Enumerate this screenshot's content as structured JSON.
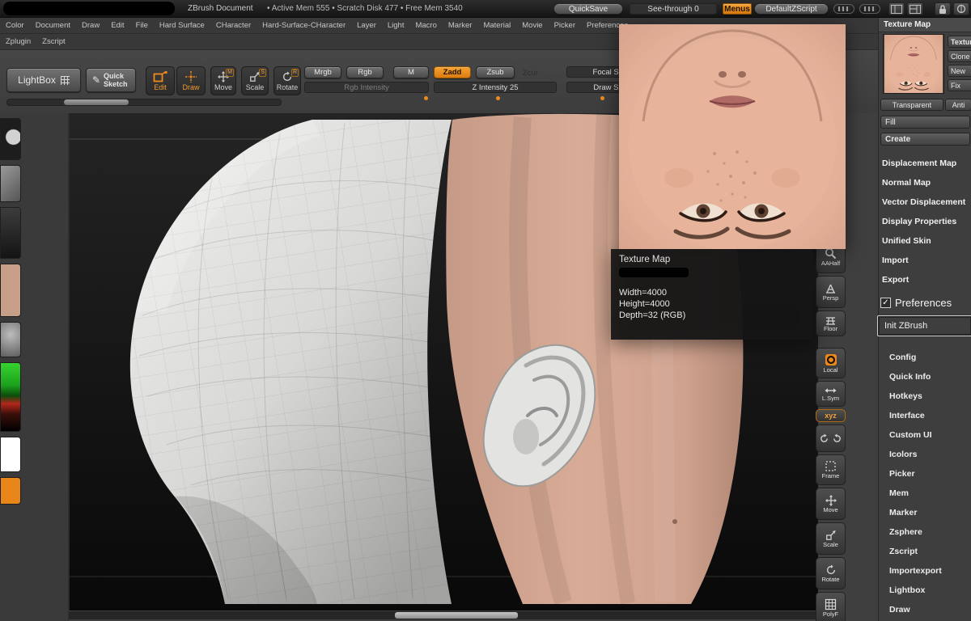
{
  "colors": {
    "accent": "#ee8a1c",
    "skin": "#d8ab96",
    "clay": "#dcdcda",
    "canvas_top": "#232323",
    "canvas_bottom": "#0a0a0a"
  },
  "title_bar": {
    "app_title": "ZBrush Document",
    "stats": "•  Active Mem 555   •  Scratch Disk 477   •  Free Mem 3540",
    "quicksave": "QuickSave",
    "see_through": "See-through  0",
    "menus": "Menus",
    "default_zscript": "DefaultZScript"
  },
  "menu_bar": {
    "row1": [
      "Color",
      "Document",
      "Draw",
      "Edit",
      "File",
      "Hard Surface",
      "CHaracter",
      "Hard-Surface-CHaracter",
      "Layer",
      "Light",
      "Macro",
      "Marker",
      "Material",
      "Movie",
      "Picker",
      "Preferences"
    ],
    "row2": [
      "Zplugin",
      "Zscript"
    ]
  },
  "shelf": {
    "lightbox": "LightBox",
    "quick_sketch": "Quick Sketch",
    "quick_sketch_icon": "✎",
    "edit": "Edit",
    "draw": "Draw",
    "move": "Move",
    "scale": "Scale",
    "rotate": "Rotate",
    "move_badge": "M",
    "scale_badge": "S",
    "rotate_badge": "R",
    "mrgb": "Mrgb",
    "rgb": "Rgb",
    "m": "M",
    "rgb_intensity": "Rgb Intensity",
    "zadd": "Zadd",
    "zsub": "Zsub",
    "zcut": "Zcut",
    "z_intensity": "Z Intensity 25",
    "focal_shift": "Focal Shift",
    "draw_size": "Draw Size"
  },
  "right_toolbar": {
    "items": [
      "AAHalf",
      "Persp",
      "Floor",
      "Local",
      "L.Sym",
      "xyz",
      "Frame",
      "Move",
      "Scale",
      "Rotate",
      "PolyF"
    ]
  },
  "texture_popup": {
    "title": "Texture Map",
    "width": "Width=4000",
    "height": "Height=4000",
    "depth": "Depth=32 (RGB)"
  },
  "right_panel": {
    "header": "Texture Map",
    "texture_on": "Texture On",
    "clone": "Clone",
    "new_txtr": "New",
    "fix": "Fix",
    "transparent": "Transparent",
    "anti": "Anti",
    "fill": "Fill",
    "create": "Create",
    "subpalettes": [
      "Displacement Map",
      "Normal Map",
      "Vector Displacement",
      "Display Properties",
      "Unified Skin",
      "Import",
      "Export"
    ],
    "preferences_check": "✓",
    "preferences": "Preferences",
    "init_zbrush": "Init ZBrush",
    "pref_items": [
      "Config",
      "Quick Info",
      "Hotkeys",
      "Interface",
      "Custom UI",
      "Icolors",
      "Picker",
      "Mem",
      "Marker",
      "Zsphere",
      "Zscript",
      "Importexport",
      "Lightbox",
      "Draw"
    ]
  }
}
